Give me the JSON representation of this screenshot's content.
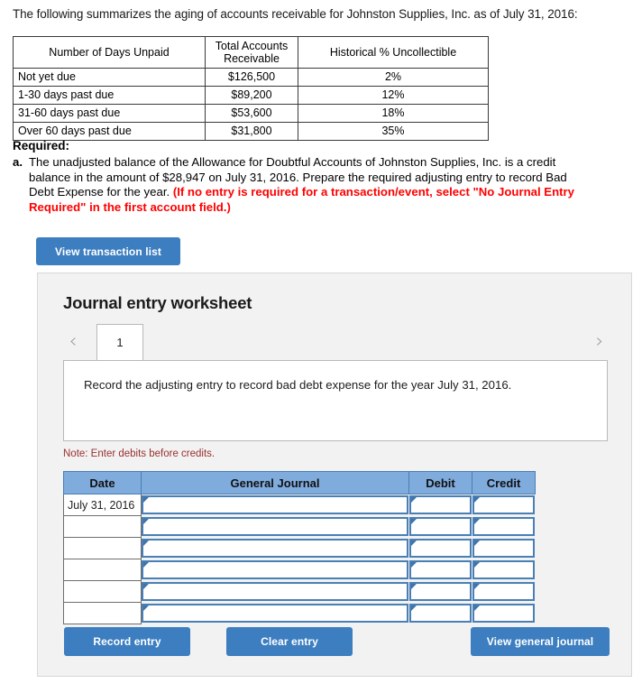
{
  "intro": {
    "text": "The following summarizes the aging of accounts receivable for Johnston Supplies, Inc. as of July 31, 2016:"
  },
  "aging_table": {
    "headers": [
      "Number of Days Unpaid",
      "Total Accounts Receivable",
      "Historical % Uncollectible"
    ],
    "header_lines": {
      "col1": "Number of Days Unpaid",
      "col2_line1": "Total Accounts",
      "col2_line2": "Receivable",
      "col3": "Historical % Uncollectible"
    },
    "rows": [
      {
        "days": "Not yet due",
        "receivable": "$126,500",
        "uncollectible": "2%"
      },
      {
        "days": "1-30 days past due",
        "receivable": "$89,200",
        "uncollectible": "12%"
      },
      {
        "days": "31-60 days past due",
        "receivable": "$53,600",
        "uncollectible": "18%"
      },
      {
        "days": "Over 60 days past due",
        "receivable": "$31,800",
        "uncollectible": "35%"
      }
    ]
  },
  "required": {
    "heading": "Required:",
    "item_marker": "a.",
    "body_black": "The unadjusted balance of the Allowance for Doubtful Accounts of Johnston Supplies, Inc. is a credit balance in the amount of $28,947 on July 31, 2016. Prepare the required adjusting entry to record Bad Debt Expense for the year. ",
    "body_red": "(If no entry is required for a transaction/event, select \"No Journal Entry Required\" in the first account field.)"
  },
  "buttons": {
    "view_transaction_list": "View transaction list",
    "record_entry": "Record entry",
    "clear_entry": "Clear entry",
    "view_general_journal": "View general journal"
  },
  "worksheet": {
    "title": "Journal entry worksheet",
    "pager": {
      "prev_icon": "‹",
      "next_icon": "›",
      "tabs": [
        "1"
      ],
      "active_tab": "1"
    },
    "description": "Record the adjusting entry to record bad debt expense for the year July 31, 2016.",
    "note": "Note: Enter debits before credits."
  },
  "journal": {
    "headers": {
      "date": "Date",
      "general_journal": "General Journal",
      "debit": "Debit",
      "credit": "Credit"
    },
    "rows": [
      {
        "date": "July 31, 2016",
        "account": "",
        "debit": "",
        "credit": ""
      },
      {
        "date": "",
        "account": "",
        "debit": "",
        "credit": ""
      },
      {
        "date": "",
        "account": "",
        "debit": "",
        "credit": ""
      },
      {
        "date": "",
        "account": "",
        "debit": "",
        "credit": ""
      },
      {
        "date": "",
        "account": "",
        "debit": "",
        "credit": ""
      },
      {
        "date": "",
        "account": "",
        "debit": "",
        "credit": ""
      }
    ]
  },
  "colors": {
    "button_blue": "#3c7ec0",
    "table_header_blue": "#7fabdd",
    "cell_border_blue": "#4a7fb5",
    "red_text": "#ff0000",
    "note_red": "#99302f",
    "panel_bg": "#f2f2f2"
  }
}
